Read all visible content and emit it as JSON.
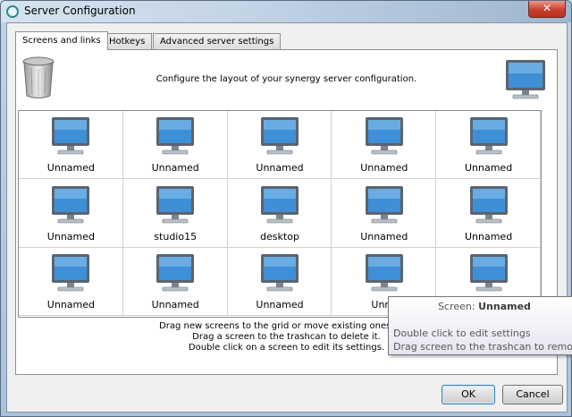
{
  "window": {
    "title": "Server Configuration",
    "close_label": "✕"
  },
  "tabs": [
    {
      "label": "Screens and links",
      "active": true
    },
    {
      "label": "Hotkeys",
      "active": false
    },
    {
      "label": "Advanced server settings",
      "active": false
    }
  ],
  "screens_tab": {
    "instruction": "Configure the layout of your synergy server configuration.",
    "grid": [
      [
        "Unnamed",
        "Unnamed",
        "Unnamed",
        "Unnamed",
        "Unnamed"
      ],
      [
        "Unnamed",
        "studio15",
        "desktop",
        "Unnamed",
        "Unnamed"
      ],
      [
        "Unnamed",
        "Unnamed",
        "Unnamed",
        "Unna",
        ""
      ]
    ],
    "hint_lines": [
      "Drag new screens to the grid or move existing ones arou",
      "Drag a screen to the trashcan to delete it.",
      "Double click on a screen to edit its settings."
    ]
  },
  "tooltip": {
    "title_prefix": "Screen: ",
    "title_name": "Unnamed",
    "line1": "Double click to edit settings",
    "line2": "Drag screen to the trashcan to remove it"
  },
  "buttons": {
    "ok": "OK",
    "cancel": "Cancel"
  },
  "colors": {
    "monitor_screen": "#3f8fd6",
    "monitor_frame": "#5a6470",
    "accent_close": "#c9402b"
  }
}
